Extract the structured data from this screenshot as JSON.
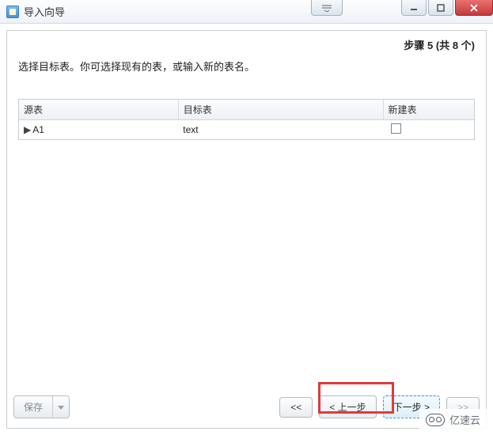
{
  "window": {
    "title": "导入向导"
  },
  "wizard": {
    "step_label": "步骤 5 (共 8 个)",
    "instruction": "选择目标表。你可选择现有的表，或输入新的表名。"
  },
  "grid": {
    "headers": {
      "source": "源表",
      "target": "目标表",
      "create": "新建表"
    },
    "rows": [
      {
        "source": "A1",
        "target": "text",
        "create": false
      }
    ]
  },
  "buttons": {
    "save": "保存",
    "first": "<<",
    "prev": "< 上一步",
    "next": "下一步 >",
    "last": ">>"
  },
  "watermark": {
    "text": "亿速云"
  }
}
